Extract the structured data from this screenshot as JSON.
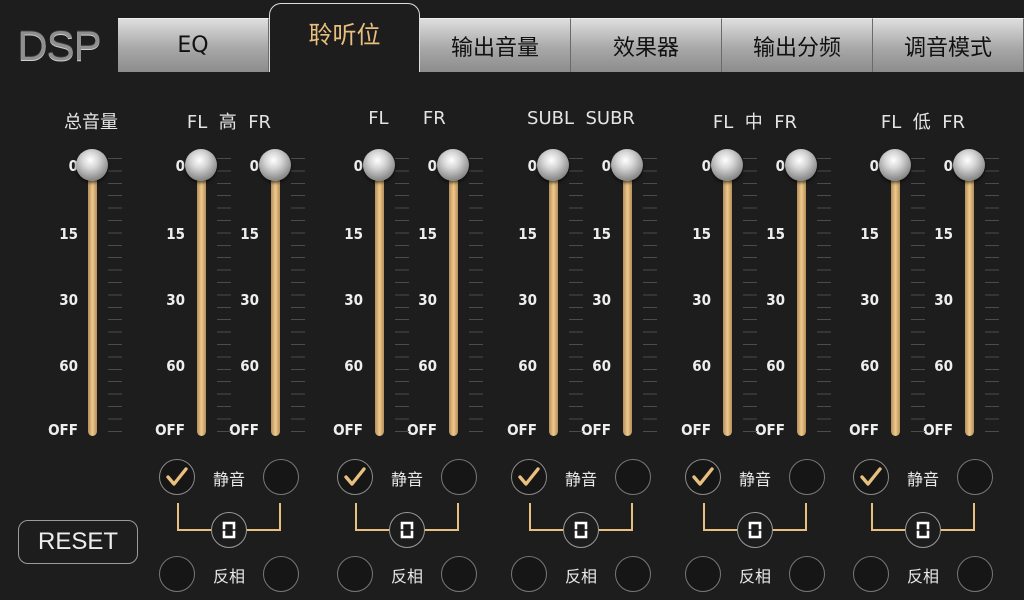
{
  "logo": "DSP",
  "tabs": [
    "EQ",
    "聆听位",
    "输出音量",
    "效果器",
    "输出分频",
    "调音模式"
  ],
  "active_tab": 1,
  "scale_labels": [
    "0",
    "15",
    "30",
    "60",
    "OFF"
  ],
  "master": {
    "title": "总音量",
    "level": 0
  },
  "channels": [
    {
      "title": "FL  高  FR",
      "left_level": 0,
      "right_level": 0,
      "mute_left": true,
      "mute_right": false
    },
    {
      "title": "FL      FR",
      "left_level": 0,
      "right_level": 0,
      "mute_left": true,
      "mute_right": false
    },
    {
      "title": "SUBL  SUBR",
      "left_level": 0,
      "right_level": 0,
      "mute_left": true,
      "mute_right": false
    },
    {
      "title": "FL  中  FR",
      "left_level": 0,
      "right_level": 0,
      "mute_left": true,
      "mute_right": false
    },
    {
      "title": "FL  低  FR",
      "left_level": 0,
      "right_level": 0,
      "mute_left": true,
      "mute_right": false
    }
  ],
  "mute_label": "静音",
  "phase_label": "反相",
  "reset_label": "RESET",
  "colors": {
    "accent": "#e8bf7e",
    "background": "#1d1d1d",
    "tab": "#b0b0b0"
  }
}
